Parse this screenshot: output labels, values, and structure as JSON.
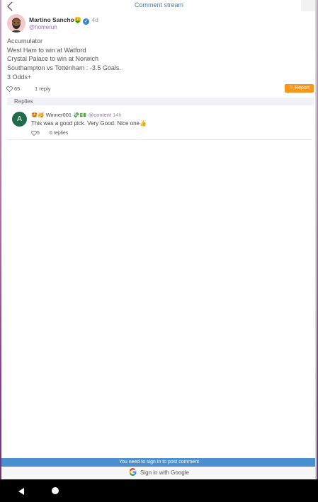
{
  "header": {
    "title": "Comment stream"
  },
  "post": {
    "author_name": "Martino Sancho🤑",
    "time": "4d",
    "handle": "@homerun",
    "lines": [
      "Accumulator",
      "West Ham to win at Watford",
      "Crystal Palace to win at Norwich",
      "Southampton vs Tottenham : -3.5 Goals.",
      "3 Odds+"
    ],
    "likes": "65",
    "reply_count": "1 reply",
    "report_label": "⚐ Report"
  },
  "replies_header": "Replies",
  "reply": {
    "avatar_letter": "A",
    "username": "🤩🥳 Winner001 💸💵",
    "handle": "@content",
    "time": "14h",
    "text": "This was a good pick. Very Good. Nice one👍",
    "likes": "5",
    "replies": "0 replies"
  },
  "footer": {
    "signin_notice": "You need to sign in to post comment",
    "google_label": "Sign in with Google"
  },
  "colors": {
    "accent": "#3a7fc0",
    "report": "#f5961d",
    "signin_bar": "#4a90d0",
    "handle": "#8c6fb8",
    "reply_avatar": "#1f6b4a"
  }
}
